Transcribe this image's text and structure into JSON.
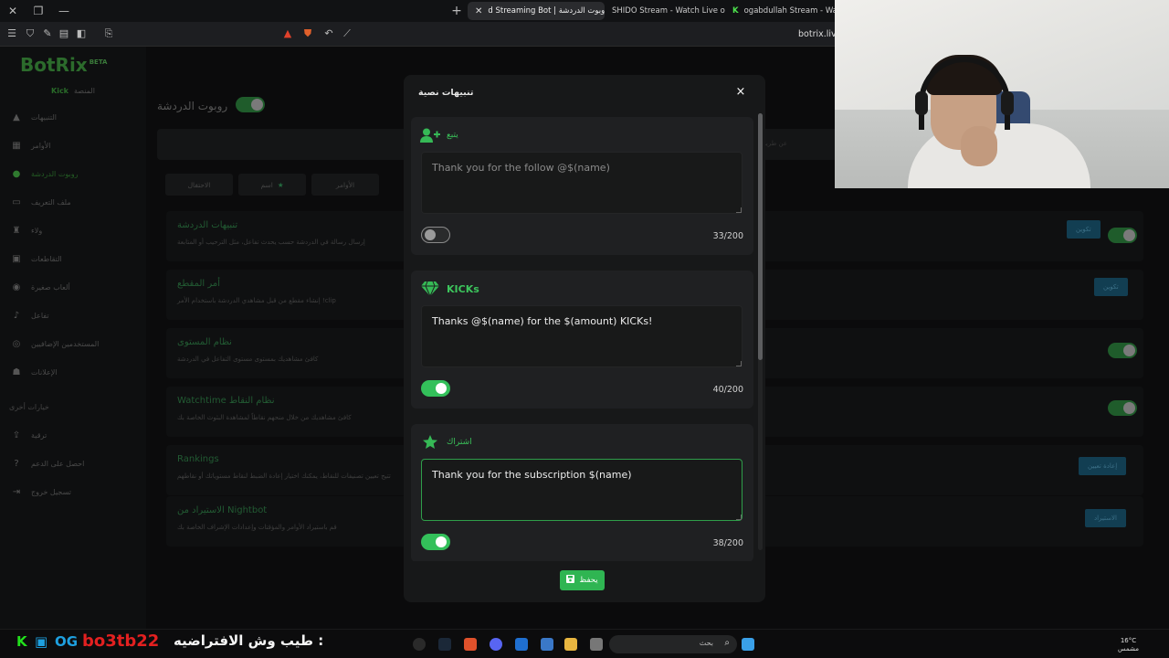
{
  "browser": {
    "tabs": [
      {
        "title": "d Streaming Bot | روبوت الدردشة",
        "active": true
      },
      {
        "title": "SHIDO Stream - Watch Live on Kick",
        "active": false
      },
      {
        "title": "ogabdullah Stream - Watch",
        "active": false
      }
    ],
    "url": "botrix.live/"
  },
  "app": {
    "logo": "BotRix",
    "logo_badge": "BETA",
    "platform_label": "المنصة",
    "platform_value": "Kick",
    "sidebar": [
      {
        "label": "التنبيهات",
        "icon": "bell-icon"
      },
      {
        "label": "الأوامر",
        "icon": "list-icon"
      },
      {
        "label": "روبوت الدردشة",
        "icon": "robot-icon",
        "active": true
      },
      {
        "label": "ملف التعريف",
        "icon": "id-card-icon"
      },
      {
        "label": "ولاء",
        "icon": "trophy-icon"
      },
      {
        "label": "التقاطعات",
        "icon": "grid-icon"
      },
      {
        "label": "ألعاب صغيرة",
        "icon": "gamepad-icon"
      },
      {
        "label": "تفاعل",
        "icon": "music-icon"
      },
      {
        "label": "المستخدمين الإضافيين",
        "icon": "eye-icon"
      },
      {
        "label": "الإعلانات",
        "icon": "users-icon"
      }
    ],
    "sidebar_section": "خيارات أخرى",
    "sidebar_extra": [
      {
        "label": "ترقية",
        "icon": "upload-icon"
      },
      {
        "label": "احصل على الدعم",
        "icon": "help-icon"
      },
      {
        "label": "تسجيل خروج",
        "icon": "logout-icon"
      }
    ],
    "page_title": "روبوت الدردشة",
    "search_hint": "عن طريق",
    "filter_tabs": [
      "الاحتفال",
      "اسم",
      "الأوامر"
    ],
    "rows": [
      {
        "title": "تنبيهات الدردشة",
        "desc": "إرسال رسالة في الدردشة حسب يحدث تفاعل، مثل الترحيب أو المتابعة",
        "button": "تكوين",
        "toggle": true
      },
      {
        "title": "أمر المقطع",
        "desc": "إنشاء مقطع من قبل مشاهدي الدردشة باستخدام الأمر !clip",
        "button": "تكوين",
        "toggle": false
      },
      {
        "title": "نظام المستوى",
        "desc": "كافئ مشاهديك بمستوى مستوى التفاعل في الدردشة",
        "button": "",
        "toggle": true
      },
      {
        "title": "Watchtime نظام النقاط",
        "desc": "كافئ مشاهديك من خلال منحهم نقاطاً لمشاهدة البثوث الخاصة بك",
        "button": "",
        "toggle": true
      },
      {
        "title": "Rankings",
        "desc": "تتيح تعيين تصنيفات للنقاط، يمكنك اختيار إعادة الضبط لنقاط مستوياتك أو نقاطهم",
        "button": "إعادة تعيين",
        "toggle": false
      },
      {
        "title": "الاستيراد من Nightbot",
        "desc": "قم باستيراد الأوامر والمؤقتات وإعدادات الإشراف الخاصة بك",
        "button": "الاستيراد",
        "toggle": false
      }
    ]
  },
  "modal": {
    "title": "تنبيهات نصية",
    "close_label": "×",
    "cards": [
      {
        "label": "يتبع",
        "icon": "user-plus-icon",
        "value": "",
        "placeholder": "Thank you for the follow @$(name)",
        "counter": "33/200",
        "enabled": false
      },
      {
        "label": "KICKs",
        "icon": "diamond-icon",
        "value": "Thanks @$(name) for the $(amount) KICKs!",
        "placeholder": "",
        "counter": "40/200",
        "enabled": true
      },
      {
        "label": "اشتراك",
        "icon": "star-icon",
        "value": "Thank you for the subscription $(name)",
        "placeholder": "",
        "counter": "38/200",
        "enabled": true
      }
    ],
    "save_label": "يحفظ",
    "accent_color": "#33c05a"
  },
  "taskbar": {
    "tag1": "OG",
    "streamer": "bo3tb22",
    "ticker": "طيب وش الافتراضيه :",
    "search_placeholder": "بحث",
    "temperature": "16°C",
    "weather": "مشمس"
  }
}
